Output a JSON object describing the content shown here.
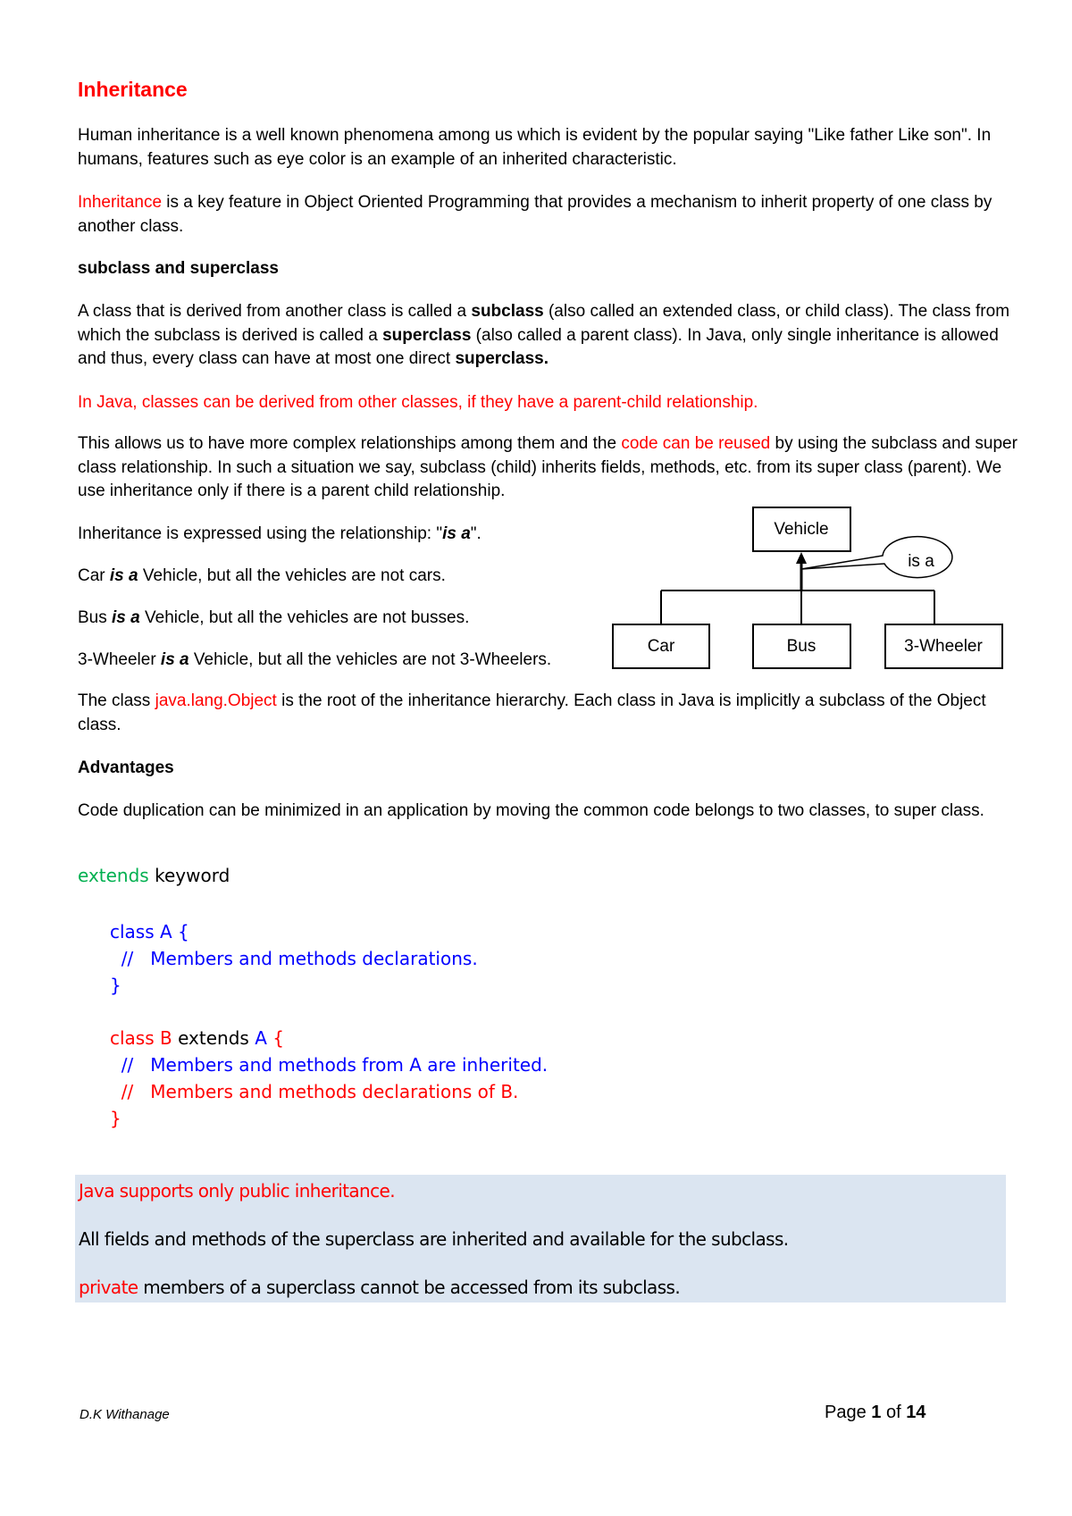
{
  "title": "Inheritance",
  "intro": {
    "p1": "Human inheritance is a well known phenomena among us which is evident by the popular saying \"Like father Like son\". In humans, features such as eye color is an example of an inherited characteristic.",
    "p2_red": "Inheritance",
    "p2_rest": " is a key feature in Object Oriented Programming that provides a mechanism to inherit property of one class by another class."
  },
  "subclass_section": {
    "heading": "subclass and superclass",
    "p1_a": "A class that is derived from another class is called a ",
    "p1_b": "subclass",
    "p1_c": " (also called an extended class, or child class). The class from which the subclass is derived is called a ",
    "p1_d": "superclass",
    "p1_e": " (also called a parent class).  In Java, only single inheritance is allowed and thus, every class can have at most one direct ",
    "p1_f": "superclass.",
    "red_note": "In Java, classes can be derived from other classes, if they have a parent-child relationship.",
    "p2_a": "This allows us to have more complex relationships among them and the ",
    "p2_red": "code can be reused",
    "p2_b": " by using the subclass and super class relationship. In such a situation we say, subclass (child) inherits fields, methods, etc. from its super class (parent).  We use inheritance only if there is a parent child relationship."
  },
  "isa_section": {
    "line1_a": "Inheritance is expressed using the relationship: \"",
    "line1_b": "is a",
    "line1_c": "\".",
    "examples": [
      {
        "subject": "Car ",
        "isa": "is a",
        "rest": " Vehicle, but all the vehicles are not cars."
      },
      {
        "subject": "Bus ",
        "isa": "is a",
        "rest": " Vehicle, but all the vehicles are not busses."
      },
      {
        "subject": "3-Wheeler ",
        "isa": "is a",
        "rest": " Vehicle, but all the vehicles are not 3-Wheelers."
      }
    ]
  },
  "diagram": {
    "parent": "Vehicle",
    "relation": "is a",
    "children": [
      "Car",
      "Bus",
      "3-Wheeler"
    ]
  },
  "object_note": {
    "a": "The class ",
    "red": "java.lang.Object",
    "b": " is the root of the inheritance hierarchy. Each class in Java is implicitly a subclass of the Object class."
  },
  "advantages": {
    "heading": "Advantages",
    "text": "Code duplication can be minimized in an application by moving the common code belongs to two classes, to super class."
  },
  "extends_section": {
    "keyword": "extends",
    "label": " keyword",
    "code": {
      "a_decl": "class A {",
      "a_comment": "  //   Members and methods declarations.",
      "a_close": "}",
      "b_decl_red": "class B",
      "b_decl_mid": " extends ",
      "b_decl_blue": "A",
      "b_decl_brace": " {",
      "b_comment1": "  //   Members and methods from A are inherited.",
      "b_comment2": "  //   Members and methods declarations of B.",
      "b_close": "}"
    }
  },
  "callout": {
    "line1": "Java supports only public inheritance.",
    "line2": "All fields and methods of the superclass are inherited and available for the subclass.",
    "line3_red": "private",
    "line3_rest": " members of a superclass cannot be accessed from its subclass."
  },
  "footer": {
    "author": "D.K Withanage",
    "page_label": "Page ",
    "page_num": "1",
    "of_label": " of ",
    "page_total": "14"
  },
  "colors": {
    "accent_red": "#ff0000",
    "code_blue": "#0000ff",
    "keyword_green": "#00b050",
    "callout_bg": "#dbe5f1"
  }
}
